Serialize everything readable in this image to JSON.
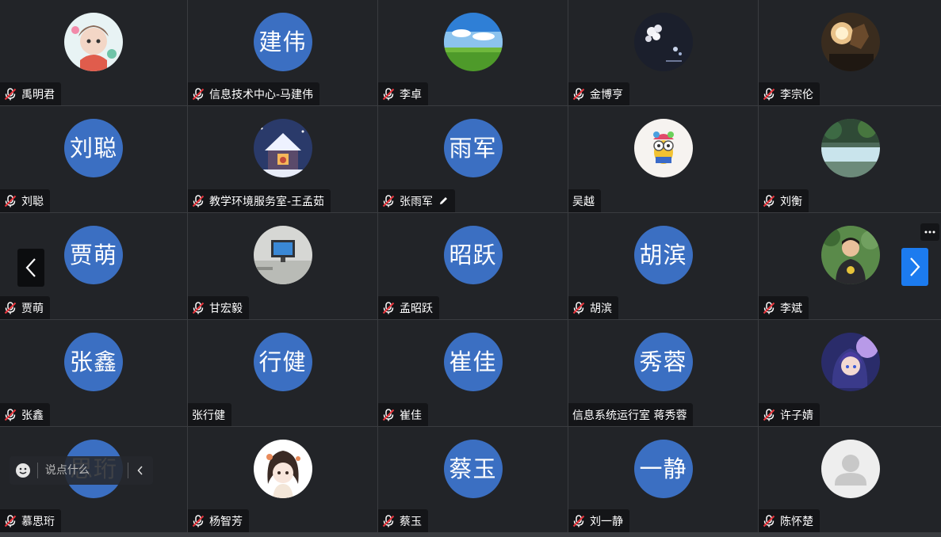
{
  "participants": [
    {
      "name": "禹明君",
      "avatar": {
        "type": "image",
        "icon": "cartoon-girl-avatar"
      },
      "muted": true
    },
    {
      "name": "信息技术中心-马建伟",
      "avatar": {
        "type": "text",
        "text": "建伟"
      },
      "muted": true
    },
    {
      "name": "李卓",
      "avatar": {
        "type": "image",
        "icon": "landscape-sky-avatar"
      },
      "muted": true
    },
    {
      "name": "金博亨",
      "avatar": {
        "type": "image",
        "icon": "night-flowers-avatar"
      },
      "muted": true
    },
    {
      "name": "李宗伦",
      "avatar": {
        "type": "image",
        "icon": "sculpture-avatar"
      },
      "muted": true
    },
    {
      "name": "刘聪",
      "avatar": {
        "type": "text",
        "text": "刘聪"
      },
      "muted": true
    },
    {
      "name": "教学环境服务室-王孟茹",
      "avatar": {
        "type": "image",
        "icon": "snow-house-avatar"
      },
      "muted": true
    },
    {
      "name": "张雨军",
      "avatar": {
        "type": "text",
        "text": "雨军"
      },
      "muted": true,
      "editing": true
    },
    {
      "name": "吴越",
      "avatar": {
        "type": "image",
        "icon": "colorful-minion-avatar"
      },
      "muted": false
    },
    {
      "name": "刘衡",
      "avatar": {
        "type": "image",
        "icon": "forest-river-avatar"
      },
      "muted": true
    },
    {
      "name": "贾萌",
      "avatar": {
        "type": "text",
        "text": "贾萌"
      },
      "muted": true
    },
    {
      "name": "甘宏毅",
      "avatar": {
        "type": "image",
        "icon": "office-screen-avatar"
      },
      "muted": true
    },
    {
      "name": "孟昭跃",
      "avatar": {
        "type": "text",
        "text": "昭跃"
      },
      "muted": true
    },
    {
      "name": "胡滨",
      "avatar": {
        "type": "text",
        "text": "胡滨"
      },
      "muted": true
    },
    {
      "name": "李斌",
      "avatar": {
        "type": "image",
        "icon": "boy-photo-avatar"
      },
      "muted": true
    },
    {
      "name": "张鑫",
      "avatar": {
        "type": "text",
        "text": "张鑫"
      },
      "muted": true
    },
    {
      "name": "张行健",
      "avatar": {
        "type": "text",
        "text": "行健"
      },
      "muted": false
    },
    {
      "name": "崔佳",
      "avatar": {
        "type": "text",
        "text": "崔佳"
      },
      "muted": true
    },
    {
      "name": "信息系统运行室 蒋秀蓉",
      "avatar": {
        "type": "text",
        "text": "秀蓉"
      },
      "muted": false
    },
    {
      "name": "许子婧",
      "avatar": {
        "type": "image",
        "icon": "anime-girl-avatar"
      },
      "muted": true
    },
    {
      "name": "慕思珩",
      "avatar": {
        "type": "text",
        "text": "思珩"
      },
      "muted": true
    },
    {
      "name": "杨智芳",
      "avatar": {
        "type": "image",
        "icon": "anime-character-avatar"
      },
      "muted": true
    },
    {
      "name": "蔡玉",
      "avatar": {
        "type": "text",
        "text": "蔡玉"
      },
      "muted": true
    },
    {
      "name": "刘一静",
      "avatar": {
        "type": "text",
        "text": "一静"
      },
      "muted": true
    },
    {
      "name": "陈怀楚",
      "avatar": {
        "type": "image",
        "icon": "default-user-avatar"
      },
      "muted": true
    }
  ],
  "chat": {
    "placeholder": "说点什么"
  },
  "colors": {
    "tile_bg": "#222428",
    "name_tag_bg": "#141518",
    "text_avatar_bg": "#3b6fc2",
    "accent": "#1c7bef"
  }
}
